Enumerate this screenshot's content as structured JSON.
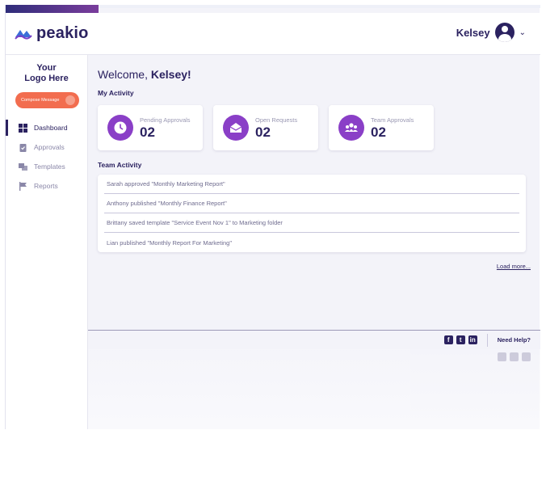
{
  "brand": {
    "name": "peakio",
    "icon": "peak-wave-icon"
  },
  "header": {
    "user_name": "Kelsey"
  },
  "sidebar": {
    "logo_text_1": "Your",
    "logo_text_2": "Logo Here",
    "compose_label": "Compose Message",
    "items": [
      {
        "label": "Dashboard",
        "icon": "dashboard-grid-icon",
        "active": true
      },
      {
        "label": "Approvals",
        "icon": "clipboard-check-icon",
        "active": false
      },
      {
        "label": "Templates",
        "icon": "templates-icon",
        "active": false
      },
      {
        "label": "Reports",
        "icon": "flag-icon",
        "active": false
      }
    ]
  },
  "main": {
    "welcome_prefix": "Welcome,",
    "welcome_name": "Kelsey!",
    "my_activity_title": "My Activity",
    "cards": [
      {
        "label": "Pending Approvals",
        "value": "02",
        "icon": "clock-icon"
      },
      {
        "label": "Open Requests",
        "value": "02",
        "icon": "envelope-open-icon"
      },
      {
        "label": "Team Approvals",
        "value": "02",
        "icon": "team-icon"
      }
    ],
    "team_activity_title": "Team Activity",
    "activity": [
      "Sarah approved \"Monthly Marketing Report\"",
      "Anthony published \"Monthly Finance Report\"",
      "Brittany saved template \"Service Event Nov 1\" to Marketing folder",
      "Lian published \"Monthly Report For Marketing\""
    ],
    "load_more": "Load more..."
  },
  "footer": {
    "social": [
      "facebook-icon",
      "twitter-icon",
      "linkedin-icon"
    ],
    "need_help": "Need Help?"
  },
  "colors": {
    "brand": "#2b2260",
    "accent": "#8a3fc7",
    "compose": "#f26d4f",
    "background": "#f3f3f9"
  }
}
